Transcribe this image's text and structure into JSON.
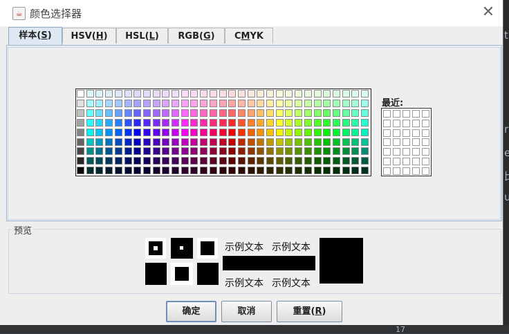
{
  "window": {
    "title": "颜色选择器",
    "icon": "java-icon"
  },
  "tabs": [
    {
      "pre": "样本(",
      "mn": "S",
      "post": ")",
      "active": true
    },
    {
      "pre": "HSV(",
      "mn": "H",
      "post": ")",
      "active": false
    },
    {
      "pre": "HSL(",
      "mn": "L",
      "post": ")",
      "active": false
    },
    {
      "pre": "RGB(",
      "mn": "G",
      "post": ")",
      "active": false
    },
    {
      "pre": "C",
      "mn": "M",
      "post": "YK",
      "active": false
    }
  ],
  "recent": {
    "label": "最近:"
  },
  "preview": {
    "title": "预览",
    "sample_text": "示例文本",
    "color": "#000000"
  },
  "buttons": {
    "ok": "确定",
    "cancel": "取消",
    "reset_pre": "重置(",
    "reset_mn": "R",
    "reset_post": ")"
  },
  "background_fragments": [
    "ti",
    "ra",
    "ex",
    "比",
    "ut",
    "17"
  ]
}
